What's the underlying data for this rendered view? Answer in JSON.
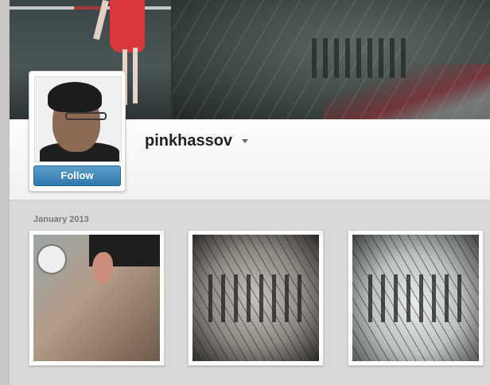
{
  "profile": {
    "username": "pinkhassov",
    "follow_label": "Follow"
  },
  "feed": {
    "section_label": "January 2013",
    "photos": [
      {
        "name": "photo-ear-clock"
      },
      {
        "name": "photo-snow-branches"
      },
      {
        "name": "photo-snow-crowd"
      }
    ]
  },
  "colors": {
    "follow_button": "#3a86bb",
    "username_text": "#222222",
    "section_label_text": "#777777"
  },
  "icons": {
    "username_menu": "chevron-down-icon"
  }
}
